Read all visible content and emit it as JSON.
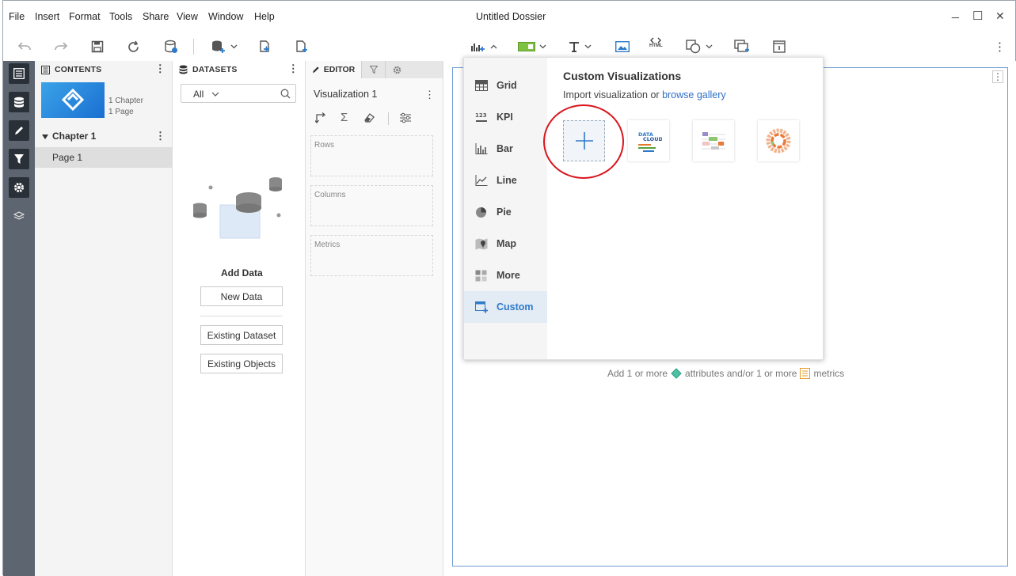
{
  "menu": [
    "File",
    "Insert",
    "Format",
    "Tools",
    "Share",
    "View",
    "Window",
    "Help"
  ],
  "window": {
    "title": "Untitled Dossier",
    "minimize": "_",
    "maximize": "☐",
    "close": "✕"
  },
  "toolbar": {
    "more": "⋮",
    "html_label": "HTML"
  },
  "contents": {
    "header": "CONTENTS",
    "meta_chapters": "1 Chapter",
    "meta_pages": "1 Page",
    "chapter": "Chapter 1",
    "page": "Page 1"
  },
  "datasets": {
    "header": "DATASETS",
    "filter_value": "All",
    "add_data_label": "Add Data",
    "new_data": "New Data",
    "existing_dataset": "Existing Dataset",
    "existing_objects": "Existing Objects"
  },
  "editor": {
    "tab": "EDITOR",
    "viz_name": "Visualization 1",
    "drop_rows": "Rows",
    "drop_columns": "Columns",
    "drop_metrics": "Metrics"
  },
  "canvas": {
    "hint_prefix": "Add 1 or more",
    "hint_attributes": "attributes and/or 1 or more",
    "hint_metrics": "metrics"
  },
  "viz_menu": {
    "items": [
      {
        "label": "Grid",
        "icon": "grid-icon"
      },
      {
        "label": "KPI",
        "icon": "kpi-icon"
      },
      {
        "label": "Bar",
        "icon": "bar-chart-icon"
      },
      {
        "label": "Line",
        "icon": "line-chart-icon"
      },
      {
        "label": "Pie",
        "icon": "pie-chart-icon"
      },
      {
        "label": "Map",
        "icon": "map-icon"
      },
      {
        "label": "More",
        "icon": "more-viz-icon"
      },
      {
        "label": "Custom",
        "icon": "custom-viz-icon"
      }
    ],
    "active": "Custom",
    "title": "Custom Visualizations",
    "import_text": "Import visualization or",
    "gallery_link": "browse gallery",
    "data_cloud_text_1": "DATA",
    "data_cloud_text_2": "CLOUD"
  },
  "colors": {
    "accent": "#2f7ac8",
    "annotation": "#d9151c",
    "rail": "#5c6570"
  }
}
